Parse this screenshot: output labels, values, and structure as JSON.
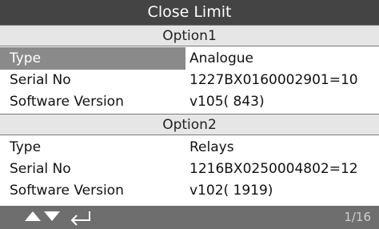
{
  "header": {
    "title": "Close Limit"
  },
  "sections": [
    {
      "title": "Option1",
      "rows": [
        {
          "label": "Type",
          "value": "Analogue"
        },
        {
          "label": "Serial No",
          "value": "1227BX0160002901=10"
        },
        {
          "label": "Software Version",
          "value": "v105( 843)"
        }
      ]
    },
    {
      "title": "Option2",
      "rows": [
        {
          "label": "Type",
          "value": "Relays"
        },
        {
          "label": "Serial No",
          "value": "1216BX0250004802=12"
        },
        {
          "label": "Software Version",
          "value": "v102( 1919)"
        }
      ]
    }
  ],
  "footer": {
    "icons": [
      "up-arrow-icon",
      "down-arrow-icon",
      "enter-icon"
    ],
    "page_indicator": "1/16"
  },
  "colors": {
    "title_bar": "#444444",
    "section_header": "#e6e6e6",
    "selected_label": "#8a8a8a",
    "footer": "#6e6e6e"
  }
}
